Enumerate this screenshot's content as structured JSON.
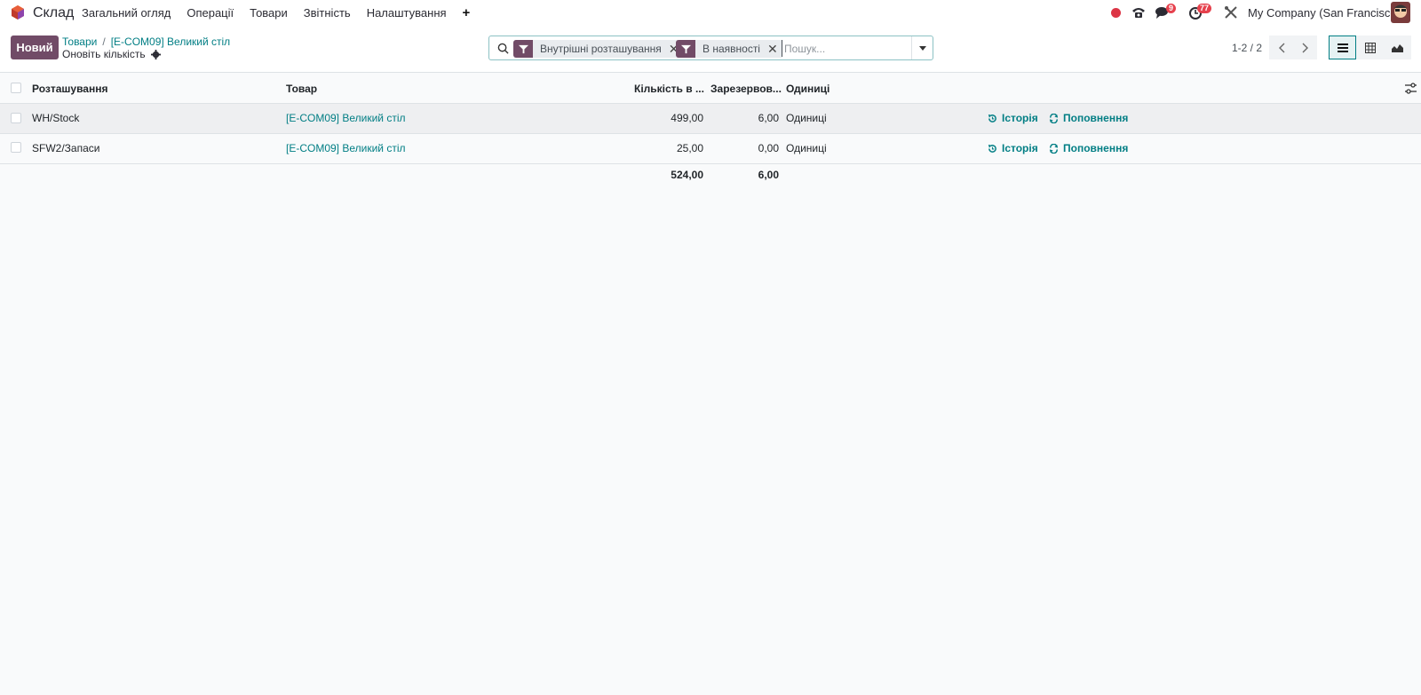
{
  "navbar": {
    "app_name": "Склад",
    "menu": [
      "Загальний огляд",
      "Операції",
      "Товари",
      "Звітність",
      "Налаштування"
    ],
    "plus": "+",
    "messages_badge": "9",
    "activities_badge": "77",
    "company": "My Company (San Francisco)"
  },
  "control": {
    "new_button": "Новий",
    "breadcrumb": [
      "Товари",
      "[E-COM09] Великий стіл"
    ],
    "breadcrumb_sep": "/",
    "sub_action": "Оновіть кількість",
    "search": {
      "facets": [
        "Внутрішні розташування",
        "В наявності"
      ],
      "placeholder": "Пошук..."
    },
    "pager": "1-2 / 2"
  },
  "table": {
    "columns": {
      "location": "Розташування",
      "product": "Товар",
      "quantity": "Кількість в ...",
      "reserved": "Зарезервов...",
      "uom": "Одиниці"
    },
    "rows": [
      {
        "location": "WH/Stock",
        "product": "[E-COM09] Великий стіл",
        "quantity": "499,00",
        "reserved": "6,00",
        "uom": "Одиниці",
        "history": "Історія",
        "replenish": "Поповнення"
      },
      {
        "location": "SFW2/Запаси",
        "product": "[E-COM09] Великий стіл",
        "quantity": "25,00",
        "reserved": "0,00",
        "uom": "Одиниці",
        "history": "Історія",
        "replenish": "Поповнення"
      }
    ],
    "totals": {
      "quantity": "524,00",
      "reserved": "6,00"
    }
  },
  "colors": {
    "brand": "#714b67",
    "link": "#017e84",
    "badge": "#e6414d"
  }
}
